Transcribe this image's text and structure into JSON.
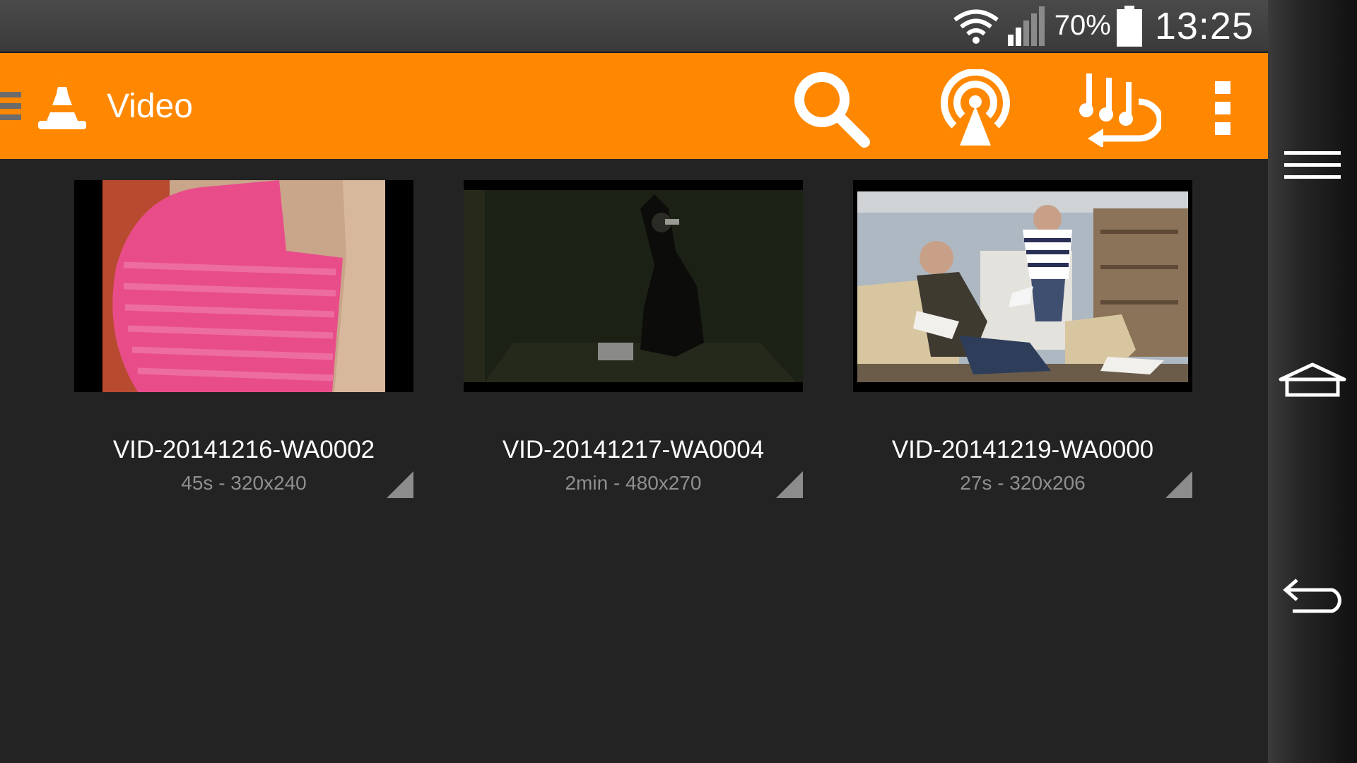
{
  "status_bar": {
    "battery_percent": "70%",
    "time": "13:25",
    "icons": [
      "wifi-icon",
      "signal-icon",
      "battery-icon"
    ]
  },
  "action_bar": {
    "title": "Video",
    "background_color": "#ff8800",
    "logo": "vlc-cone-icon",
    "actions": [
      "search-icon",
      "stream-icon",
      "audio-switch-icon",
      "overflow-menu-icon"
    ]
  },
  "videos": [
    {
      "title": "VID-20141216-WA0002",
      "meta": "45s - 320x240"
    },
    {
      "title": "VID-20141217-WA0004",
      "meta": "2min - 480x270"
    },
    {
      "title": "VID-20141219-WA0000",
      "meta": "27s - 320x206"
    }
  ],
  "nav_bar": {
    "buttons": [
      "menu-icon",
      "home-icon",
      "back-icon"
    ]
  }
}
